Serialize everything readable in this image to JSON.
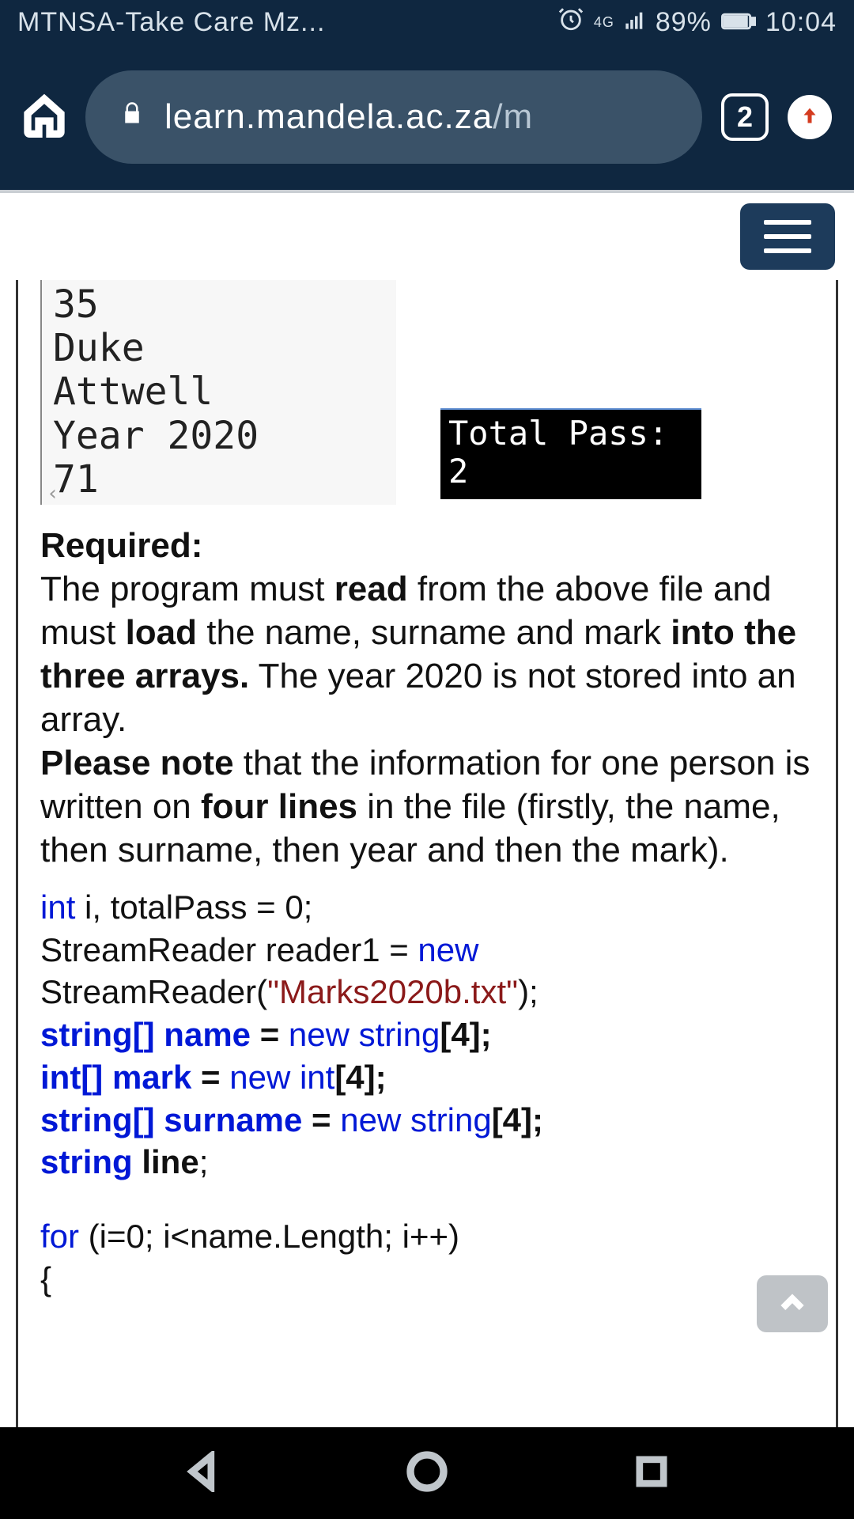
{
  "status": {
    "carrier": "MTNSA-Take Care Mz...",
    "network": "4G",
    "battery": "89%",
    "time": "10:04"
  },
  "browser": {
    "url_host": "learn.mandela.ac.za",
    "url_path": "/m",
    "tab_count": "2"
  },
  "file_preview": {
    "l1": "35",
    "l2": "Duke",
    "l3": "Attwell",
    "l4": "Year 2020",
    "l5": "71"
  },
  "console": {
    "l1": "Total Pass:",
    "l2": "2"
  },
  "req": {
    "heading": "Required:",
    "p1a": "The program must ",
    "p1b": "read",
    "p1c": " from the above file and must ",
    "p1d": "load",
    "p1e": " the name, surname and mark ",
    "p1f": "into the three arrays.",
    "p1g": " The year 2020 is not stored into an array.",
    "p2a": "Please note",
    "p2b": " that the information for one person is written on ",
    "p2c": "four lines",
    "p2d": " in the file (firstly, the name, then surname, then year and then the mark)."
  },
  "code": {
    "l1_kw": "int",
    "l1_rest": " i, totalPass = 0;",
    "l2_a": "StreamReader reader1 = ",
    "l2_kw": "new",
    "l3_a": "StreamReader(",
    "l3_str": "\"Marks2020b.txt\"",
    "l3_b": ");",
    "l4_a": "string[] name",
    "l4_eq": " = ",
    "l4_kw": "new string",
    "l4_b": "[4];",
    "l5_a": "int[] mark",
    "l5_eq": " = ",
    "l5_kw": "new int",
    "l5_b": "[4];",
    "l6_a": "string[] surname",
    "l6_eq": " = ",
    "l6_kw": "new string",
    "l6_b": "[4];",
    "l7_a": "string",
    "l7_b": " line",
    "l7_c": ";",
    "l8_kw": "for",
    "l8_rest": " (i=0; i<name.Length; i++)",
    "l9": "{"
  }
}
